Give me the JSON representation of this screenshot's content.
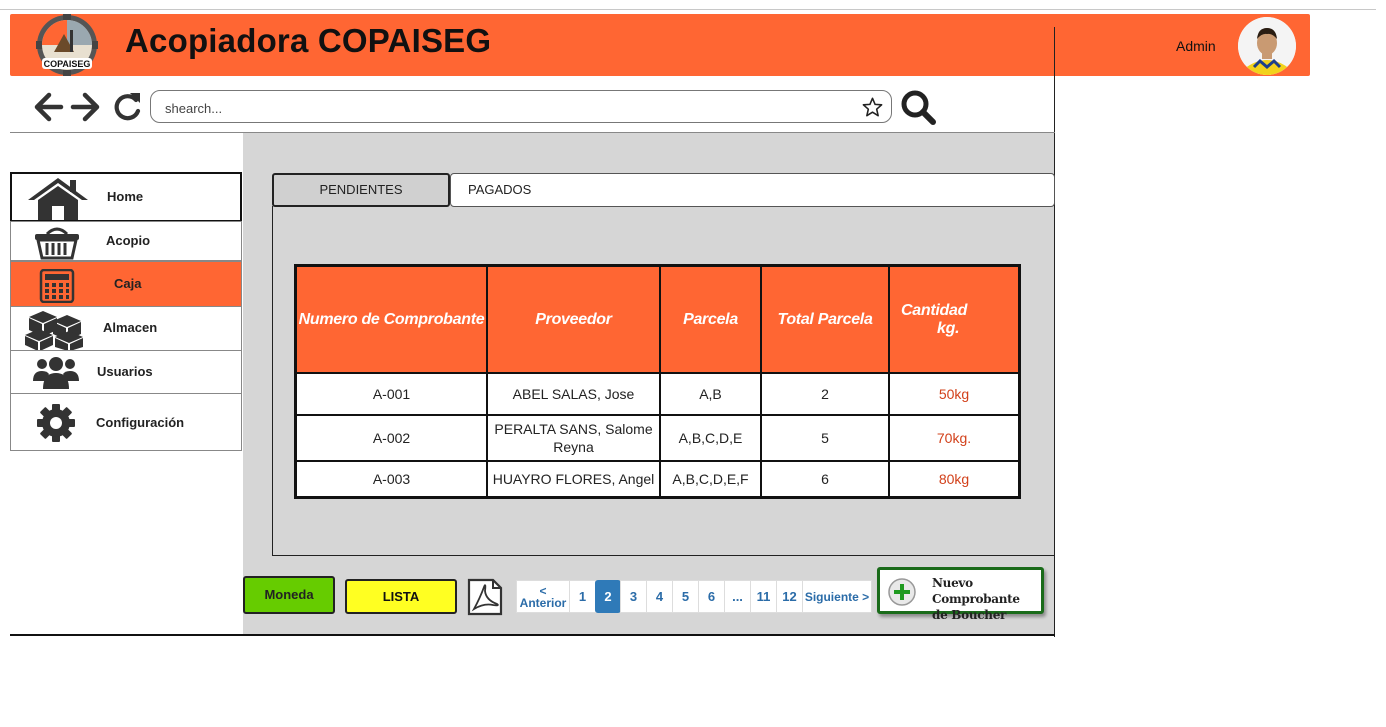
{
  "header": {
    "title": "Acopiadora COPAISEG",
    "logo_text": "COPAISEG",
    "user_label": "Admin"
  },
  "toolbar": {
    "search_placeholder": "shearch..."
  },
  "sidebar": {
    "items": [
      {
        "label": "Home",
        "icon": "home-icon"
      },
      {
        "label": "Acopio",
        "icon": "basket-icon"
      },
      {
        "label": "Caja",
        "icon": "calculator-icon",
        "active": true
      },
      {
        "label": "Almacen",
        "icon": "boxes-icon"
      },
      {
        "label": "Usuarios",
        "icon": "users-icon"
      },
      {
        "label": "Configuración",
        "icon": "gear-icon"
      }
    ]
  },
  "tabs": [
    {
      "label": "PENDIENTES",
      "selected": true
    },
    {
      "label": "PAGADOS"
    }
  ],
  "table": {
    "headers": [
      "Numero de Comprobante",
      "Proveedor",
      "Parcela",
      "Total Parcela",
      "Cantidad",
      "kg."
    ],
    "rows": [
      [
        "A-001",
        "ABEL SALAS, Jose",
        "A,B",
        "2",
        "50kg"
      ],
      [
        "A-002",
        "PERALTA SANS, Salome",
        "Reyna",
        "A,B,C,D,E",
        "5",
        "70kg."
      ],
      [
        "A-003",
        "HUAYRO FLORES, Angel",
        "A,B,C,D,E,F",
        "6",
        "80kg"
      ]
    ]
  },
  "actions": {
    "moneda": "Moneda",
    "lista": "LISTA",
    "nuevo_line1": "Nuevo Comprobante",
    "nuevo_line2": "de Boucher"
  },
  "pagination": {
    "prev_arrow": "<",
    "prev": "Anterior",
    "pages": [
      "1",
      "2",
      "3",
      "4",
      "5",
      "6",
      "...",
      "11",
      "12"
    ],
    "current": "2",
    "next": "Siguiente >"
  },
  "colors": {
    "brand": "#ff6633",
    "moneda": "#66cc00",
    "lista": "#ffff22",
    "nuevo_border": "#1a6b1a",
    "kg_text": "#d2401a",
    "pager_active": "#2f7ab8"
  }
}
